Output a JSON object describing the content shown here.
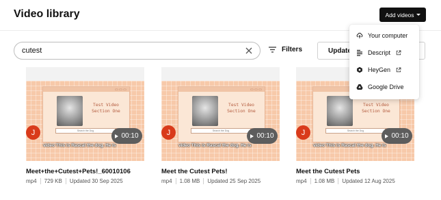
{
  "header": {
    "title": "Video library"
  },
  "add_videos": {
    "label": "Add videos",
    "menu": [
      {
        "label": "Your computer",
        "icon": "upload-cloud-icon",
        "external": false
      },
      {
        "label": "Descript",
        "icon": "descript-logo-icon",
        "external": true
      },
      {
        "label": "HeyGen",
        "icon": "heygen-logo-icon",
        "external": true
      },
      {
        "label": "Google Drive",
        "icon": "google-drive-icon",
        "external": false
      }
    ]
  },
  "search": {
    "value": "cutest"
  },
  "filters": {
    "label": "Filters"
  },
  "update": {
    "label": "Updated"
  },
  "thumbnail": {
    "slide_title_line1": "Test Video",
    "slide_title_line2": "Section One",
    "slide_search_text": "Search the Dog",
    "caption": "This is Rascal the dog. He is",
    "caption_tag": "video"
  },
  "videos": [
    {
      "title": "Meet+the+Cutest+Pets!_60010106",
      "format": "mp4",
      "size": "729 KB",
      "updated": "Updated 30 Sep 2025",
      "duration": "00:10",
      "avatar": "J"
    },
    {
      "title": "Meet the Cutest Pets!",
      "format": "mp4",
      "size": "1.08 MB",
      "updated": "Updated 25 Sep 2025",
      "duration": "00:10",
      "avatar": "J"
    },
    {
      "title": "Meet the Cutest Pets",
      "format": "mp4",
      "size": "1.08 MB",
      "updated": "Updated 12 Aug 2025",
      "duration": "00:10",
      "avatar": "J"
    }
  ],
  "colors": {
    "accent": "#111111",
    "avatar": "#d93a1a",
    "thumb_bg": "#f7c9a9"
  }
}
